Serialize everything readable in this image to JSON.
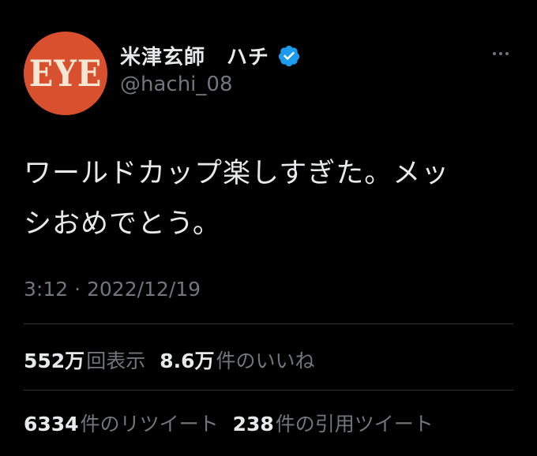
{
  "user": {
    "avatar_text": "EYE",
    "display_name": "米津玄師　ハチ",
    "handle": "@hachi_08",
    "verified_icon": "verified-badge-icon"
  },
  "tweet": {
    "text": "ワールドカップ楽しすぎた。メッ\nシおめでとう。",
    "timestamp": "3:12 · 2022/12/19"
  },
  "stats_row1": [
    {
      "value": "552万",
      "label": "回表示"
    },
    {
      "value": "8.6万",
      "label": "件のいいね"
    }
  ],
  "stats_row2": [
    {
      "value": "6334",
      "label": "件のリツイート"
    },
    {
      "value": "238",
      "label": "件の引用ツイート"
    }
  ],
  "colors": {
    "background": "#000000",
    "text_primary": "#e7e9ea",
    "text_secondary": "#71767b",
    "verified_blue": "#1d9bf0",
    "avatar_bg": "#d9502e",
    "divider": "#2f3336"
  }
}
